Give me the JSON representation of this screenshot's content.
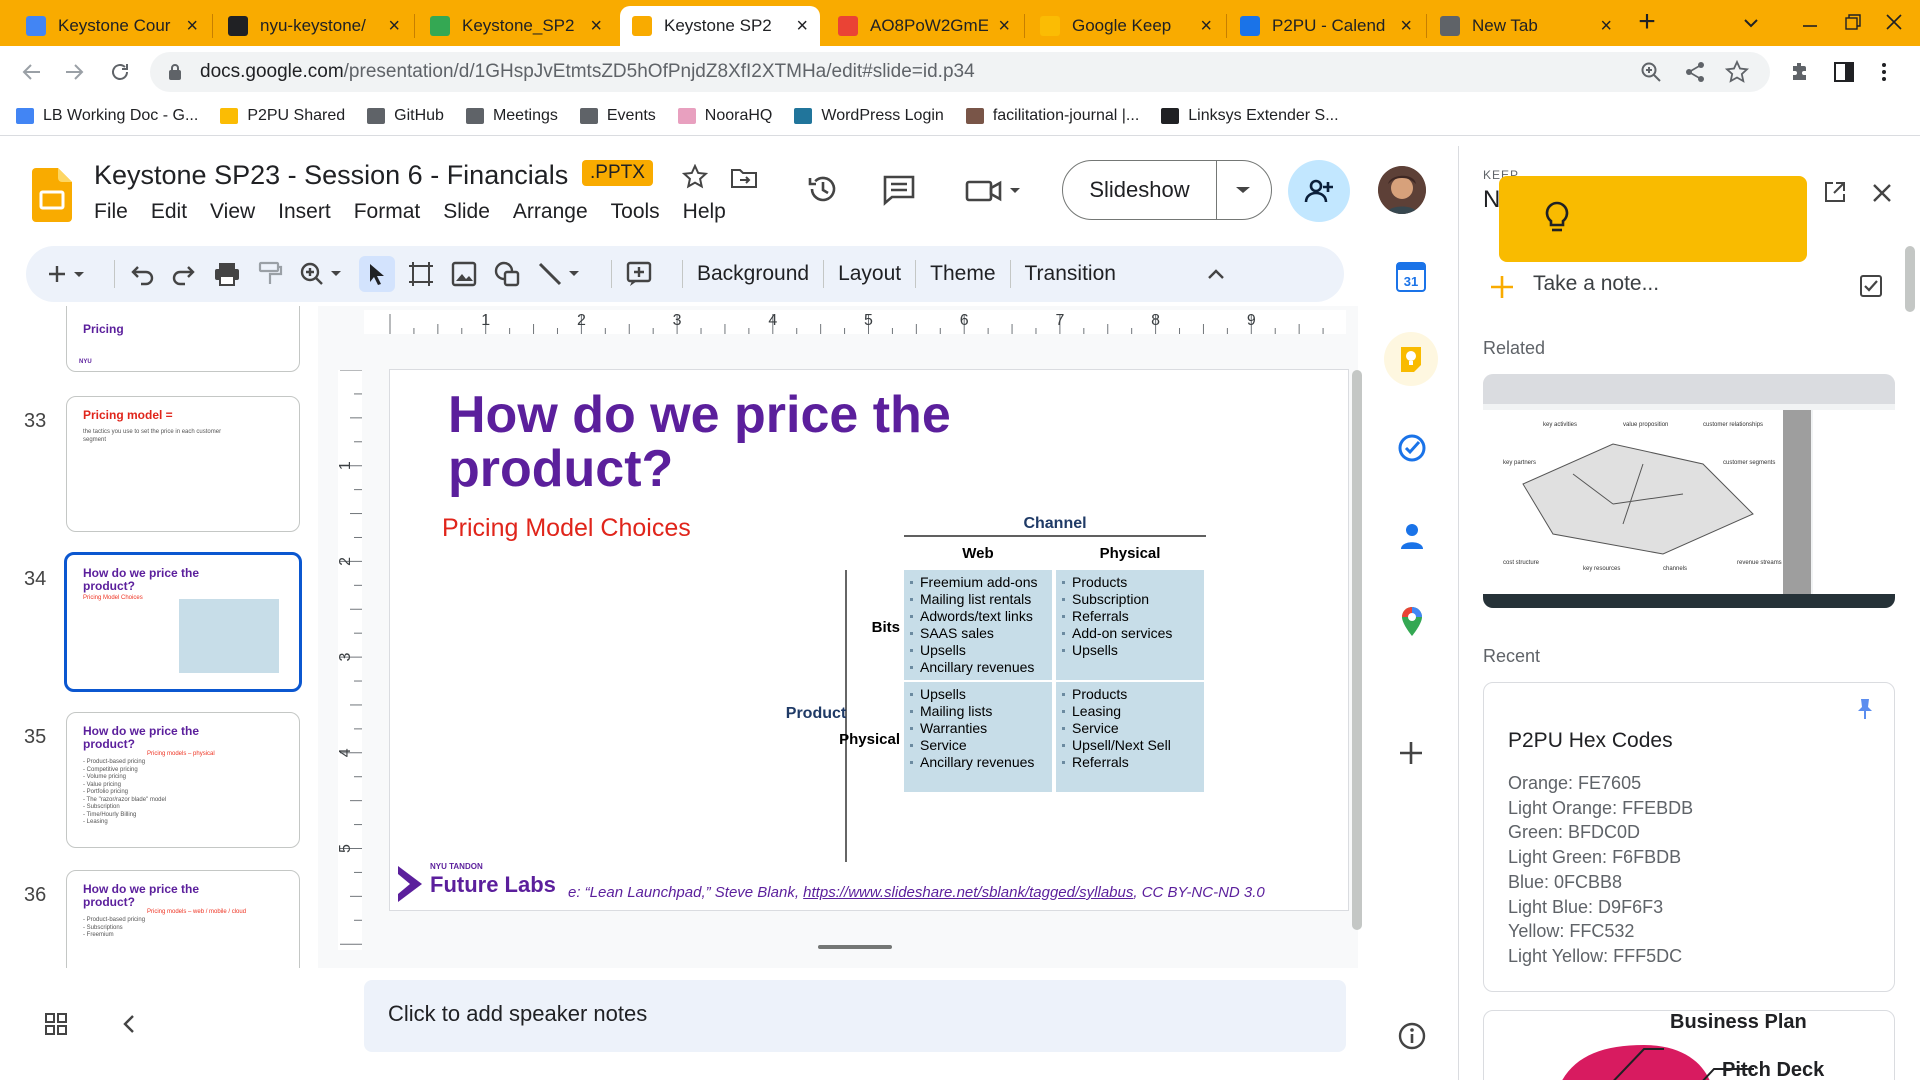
{
  "browser": {
    "tabs": [
      {
        "title": "Keystone Cour",
        "favicon_color": "#4285f4",
        "favicon": "docs-icon"
      },
      {
        "title": "nyu-keystone/",
        "favicon_color": "#202124",
        "favicon": "github-icon"
      },
      {
        "title": "Keystone_SP2",
        "favicon_color": "#34a853",
        "favicon": "drive-icon"
      },
      {
        "title": "Keystone SP2",
        "favicon_color": "#f9ab00",
        "favicon": "slides-icon"
      },
      {
        "title": "AO8PoW2GmE",
        "favicon_color": "#ea4335",
        "favicon": "acrobat-icon"
      },
      {
        "title": "Google Keep",
        "favicon_color": "#fbbc04",
        "favicon": "keep-icon"
      },
      {
        "title": "P2PU - Calend",
        "favicon_color": "#1a73e8",
        "favicon": "calendar-icon"
      },
      {
        "title": "New Tab",
        "favicon_color": "#5f6368",
        "favicon": "chrome-icon"
      }
    ],
    "url_host": "docs.google.com",
    "url_path": "/presentation/d/1GHspJvEtmtsZD5hOfPnjdZ8XfI2XTMHa/edit#slide=id.p34",
    "bookmarks": [
      "LB Working Doc - G...",
      "P2PU Shared",
      "GitHub",
      "Meetings",
      "Events",
      "NooraHQ",
      "WordPress Login",
      "facilitation-journal |...",
      "Linksys Extender S..."
    ]
  },
  "doc": {
    "title": "Keystone SP23 - Session 6 - Financials",
    "badge": ".PPTX",
    "menus": [
      "File",
      "Edit",
      "View",
      "Insert",
      "Format",
      "Slide",
      "Arrange",
      "Tools",
      "Help"
    ],
    "slideshow_label": "Slideshow"
  },
  "toolbar": {
    "background": "Background",
    "layout": "Layout",
    "theme": "Theme",
    "transition": "Transition"
  },
  "ruler": {
    "h_ticks": [
      "1",
      "2",
      "3",
      "4",
      "5",
      "6",
      "7",
      "8",
      "9"
    ],
    "v_ticks": [
      "1",
      "2",
      "3",
      "4",
      "5"
    ]
  },
  "filmstrip": {
    "partial_title": "Pricing",
    "slides": [
      {
        "number": "33",
        "title": "Pricing model =",
        "subtitle": "the tactics you use to set the price in each customer segment",
        "selected": false
      },
      {
        "number": "34",
        "title": "How do we price the product?",
        "subtitle": "Pricing Model Choices",
        "selected": true
      },
      {
        "number": "35",
        "title": "How do we price the product?",
        "subtitle": "Pricing models – physical",
        "lines": [
          "- Product-based pricing",
          "- Competitive pricing",
          "- Volume pricing",
          "- Value pricing",
          "- Portfolio pricing",
          "- The \"razor/razor blade\" model",
          "- Subscription",
          "- Time/Hourly Billing",
          "- Leasing"
        ],
        "selected": false
      },
      {
        "number": "36",
        "title": "How do we price the product?",
        "subtitle": "Pricing models – web / mobile / cloud",
        "lines": [
          "- Product-based pricing",
          "- Subscriptions",
          "- Freemium"
        ],
        "selected": false
      }
    ]
  },
  "slide": {
    "title": "How do we price the product?",
    "subtitle": "Pricing Model Choices",
    "table": {
      "channel_header": "Channel",
      "col_headers": [
        "Web",
        "Physical"
      ],
      "row_group_label": "Product",
      "rows": [
        {
          "label": "Bits",
          "cells": [
            [
              "Freemium add-ons",
              "Mailing list rentals",
              "Adwords/text links",
              "SAAS sales",
              "Upsells",
              "Ancillary revenues"
            ],
            [
              "Products",
              "Subscription",
              "Referrals",
              "Add-on services",
              "Upsells"
            ]
          ]
        },
        {
          "label": "Physical",
          "cells": [
            [
              "Upsells",
              "Mailing lists",
              "Warranties",
              "Service",
              "Ancillary revenues"
            ],
            [
              "Products",
              "Leasing",
              "Service",
              "Upsell/Next Sell",
              "Referrals"
            ]
          ]
        }
      ]
    },
    "logo_small": "NYU TANDON",
    "logo": "Future Labs",
    "source_prefix": "e: “Lean Launchpad,” Steve Blank, ",
    "source_link": "https://www.slideshare.net/sblank/tagged/syllabus",
    "source_suffix": ", CC BY-NC-ND 3.0"
  },
  "notes": {
    "placeholder": "Click to add speaker notes"
  },
  "keep": {
    "header_small": "KEEP",
    "header_initial": "N",
    "take_note": "Take a note...",
    "related_label": "Related",
    "recent_label": "Recent",
    "related_preview_labels": [
      "key activities",
      "value proposition",
      "customer relationships",
      "key partners",
      "customer segments",
      "cost structure",
      "key resources",
      "channels",
      "revenue streams"
    ],
    "recent_note": {
      "title": "P2PU Hex Codes",
      "lines": [
        "Orange: FE7605",
        "Light Orange: FFEBDB",
        "Green: BFDC0D",
        "Light Green: F6FBDB",
        "Blue: 0FCBB8",
        "Light Blue: D9F6F3",
        "Yellow: FFC532",
        "Light Yellow: FFF5DC"
      ]
    },
    "next_note_labels": [
      "Business Plan",
      "Pitch Deck"
    ]
  },
  "colors": {
    "chrome_accent": "#f9ab00",
    "slide_title": "#5b1f9c",
    "slide_subtitle": "#e0251b",
    "table_cell": "#c7dde8",
    "table_header": "#1f3a66",
    "selection_blue": "#0b57d0",
    "keep_yellow": "#f9bb00"
  }
}
